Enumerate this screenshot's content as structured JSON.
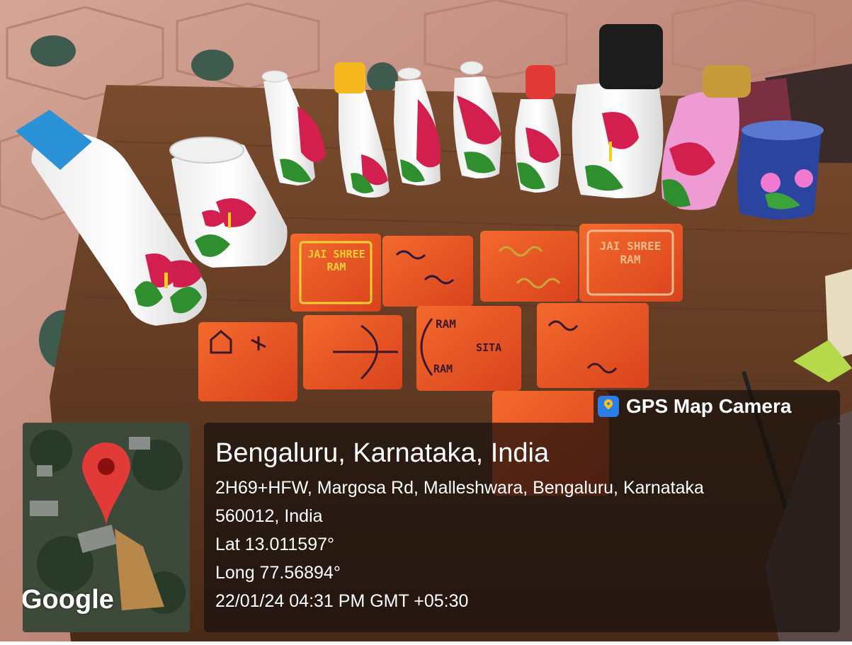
{
  "badge": {
    "icon": "gps-map-camera-app-icon",
    "label": "GPS Map Camera"
  },
  "map": {
    "icon": "map-pin-icon",
    "watermark": "Google"
  },
  "location": {
    "title": "Bengaluru, Karnataka, India",
    "address_line1": "2H69+HFW, Margosa Rd, Malleshwara, Bengaluru, Karnataka",
    "address_line2": "560012, India",
    "latitude": "Lat 13.011597°",
    "longitude": "Long 77.56894°",
    "datetime": "22/01/24 04:31 PM GMT +05:30"
  },
  "crafts": {
    "plaque_text_1": "JAI SHREE RAM",
    "plaque_text_2": "JAI SHREE RAM",
    "plaque_text_3": "RAM",
    "plaque_text_4": "SITA",
    "plaque_text_5": "RAM"
  },
  "colors": {
    "table": "#6b4226",
    "floor": "#c98f80",
    "plaque": "#ef5a26",
    "panel": "#18100e",
    "pin": "#e23a36"
  }
}
